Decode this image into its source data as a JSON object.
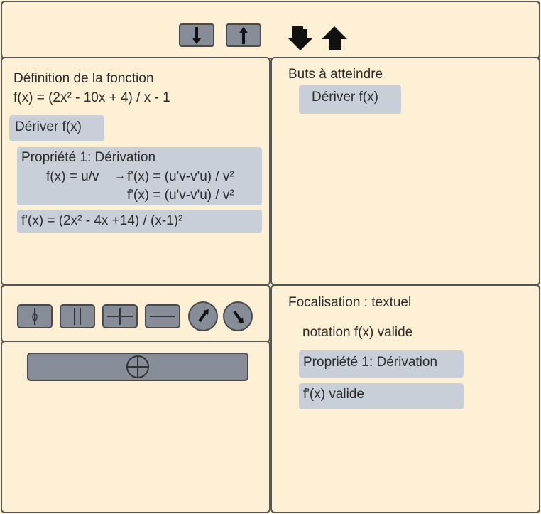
{
  "toolbar": {
    "buttons": [
      {
        "icon": "arrow-down-icon"
      },
      {
        "icon": "arrow-up-icon"
      }
    ],
    "arrows": [
      {
        "icon": "big-arrow-down-icon"
      },
      {
        "icon": "big-arrow-up-icon"
      }
    ]
  },
  "definition": {
    "title": "Définition de la fonction",
    "formula": "f(x) = (2x² - 10x + 4) / x - 1",
    "action": "Dériver f(x)",
    "property": {
      "title": "Propriété 1: Dérivation",
      "rule_lhs": "f(x) = u/v",
      "rule_arrow": "→",
      "rule_rhs": "f'(x) = (u'v-v'u) / v²",
      "rule_line2": "f'(x) = (u'v-v'u) / v²"
    },
    "result": "f'(x) = (2x² - 4x +14) / (x-1)²"
  },
  "goals": {
    "title": "Buts à atteindre",
    "items": [
      "Dériver f(x)"
    ]
  },
  "tools": {
    "items": [
      {
        "icon": "phi-icon"
      },
      {
        "icon": "parallel-lines-icon"
      },
      {
        "icon": "plus-icon"
      },
      {
        "icon": "minus-icon"
      },
      {
        "icon": "rotate-right-icon"
      },
      {
        "icon": "rotate-left-icon"
      }
    ],
    "add_icon": "circled-plus-icon"
  },
  "focus": {
    "title": "Focalisation : textuel",
    "notation": "notation f(x) valide",
    "items": [
      "Propriété 1: Dérivation",
      "f'(x) valide"
    ]
  },
  "colors": {
    "background": "#fdf0d5",
    "button": "#868c98",
    "chip": "#c9cfd8",
    "border": "#555555"
  }
}
